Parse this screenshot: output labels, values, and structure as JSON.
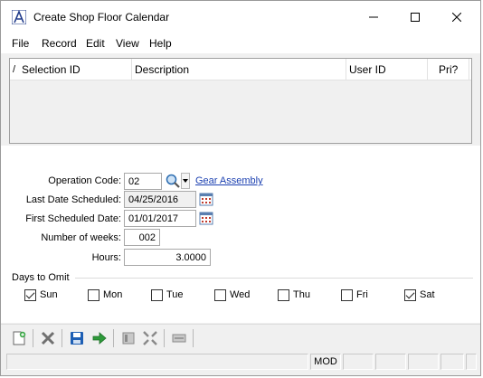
{
  "window": {
    "title": "Create Shop Floor Calendar"
  },
  "menu": {
    "items": [
      "File",
      "Record",
      "Edit",
      "View",
      "Help"
    ]
  },
  "grid": {
    "marker": "/",
    "columns": [
      "Selection ID",
      "Description",
      "User ID",
      "Pri?"
    ],
    "rows": []
  },
  "form": {
    "operation_code": {
      "label": "Operation Code:",
      "value": "02",
      "description_link": "Gear Assembly"
    },
    "last_date_scheduled": {
      "label": "Last Date Scheduled:",
      "value": "04/25/2016"
    },
    "first_scheduled_date": {
      "label": "First Scheduled Date:",
      "value": "01/01/2017"
    },
    "number_of_weeks": {
      "label": "Number of weeks:",
      "value": "002"
    },
    "hours": {
      "label": "Hours:",
      "value": "3.0000"
    }
  },
  "days_to_omit": {
    "label": "Days to Omit",
    "days": [
      {
        "label": "Sun",
        "checked": true
      },
      {
        "label": "Mon",
        "checked": false
      },
      {
        "label": "Tue",
        "checked": false
      },
      {
        "label": "Wed",
        "checked": false
      },
      {
        "label": "Thu",
        "checked": false
      },
      {
        "label": "Fri",
        "checked": false
      },
      {
        "label": "Sat",
        "checked": true
      }
    ]
  },
  "toolbar": {
    "icons": [
      "new-record-icon",
      "delete-icon",
      "save-icon",
      "process-icon",
      "first-icon",
      "collapse-icon",
      "minus-icon"
    ]
  },
  "statusbar": {
    "mode": "MOD"
  },
  "colors": {
    "link": "#1a3fb0",
    "window_bg": "#f0f0f0",
    "save_blue": "#1e5fb4",
    "process_green": "#2e9a3a"
  }
}
